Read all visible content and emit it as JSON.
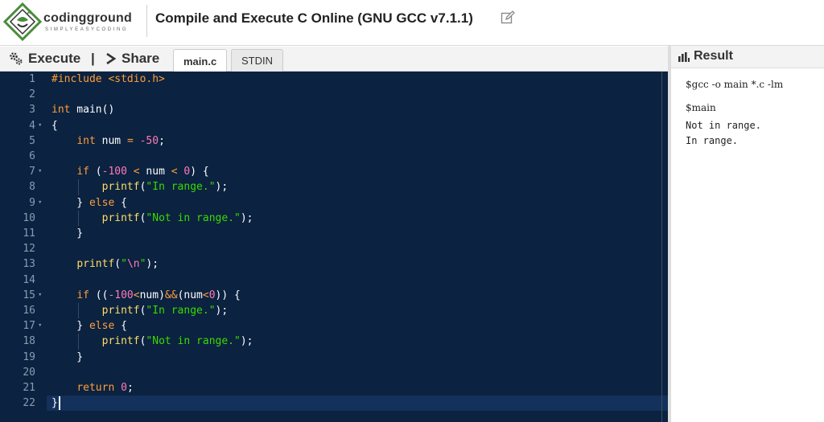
{
  "header": {
    "logo_name": "codingground",
    "logo_tagline": "SIMPLYEASYCODING",
    "title": "Compile and Execute C Online (GNU GCC v7.1.1)",
    "edit_icon": "edit-icon"
  },
  "toolbar": {
    "execute_label": "Execute",
    "execute_icon": "gears-icon",
    "separator": "|",
    "share_label": "Share",
    "share_icon": "chevron-right-icon",
    "tabs": [
      {
        "label": "main.c",
        "active": true
      },
      {
        "label": "STDIN",
        "active": false
      }
    ]
  },
  "editor": {
    "active_line": 22,
    "foldable_lines": [
      4,
      7,
      9,
      15,
      17
    ],
    "lines": [
      [
        [
          "pp",
          "#include <stdio.h>"
        ]
      ],
      [],
      [
        [
          "kw",
          "int"
        ],
        [
          "plain",
          " main()"
        ]
      ],
      [
        [
          "plain",
          "{"
        ]
      ],
      [
        [
          "plain",
          "    "
        ],
        [
          "kw",
          "int"
        ],
        [
          "plain",
          " num "
        ],
        [
          "op",
          "="
        ],
        [
          "plain",
          " "
        ],
        [
          "num",
          "-50"
        ],
        [
          "plain",
          ";"
        ]
      ],
      [],
      [
        [
          "plain",
          "    "
        ],
        [
          "kw",
          "if"
        ],
        [
          "plain",
          " ("
        ],
        [
          "num",
          "-100"
        ],
        [
          "plain",
          " "
        ],
        [
          "op",
          "<"
        ],
        [
          "plain",
          " num "
        ],
        [
          "op",
          "<"
        ],
        [
          "plain",
          " "
        ],
        [
          "num",
          "0"
        ],
        [
          "plain",
          ") {"
        ]
      ],
      [
        [
          "plain",
          "        "
        ],
        [
          "fn",
          "printf"
        ],
        [
          "plain",
          "("
        ],
        [
          "str",
          "\"In range.\""
        ],
        [
          "plain",
          ");"
        ]
      ],
      [
        [
          "plain",
          "    } "
        ],
        [
          "kw",
          "else"
        ],
        [
          "plain",
          " {"
        ]
      ],
      [
        [
          "plain",
          "        "
        ],
        [
          "fn",
          "printf"
        ],
        [
          "plain",
          "("
        ],
        [
          "str",
          "\"Not in range.\""
        ],
        [
          "plain",
          ");"
        ]
      ],
      [
        [
          "plain",
          "    }"
        ]
      ],
      [],
      [
        [
          "plain",
          "    "
        ],
        [
          "fn",
          "printf"
        ],
        [
          "plain",
          "("
        ],
        [
          "str",
          "\""
        ],
        [
          "esc",
          "\\n"
        ],
        [
          "str",
          "\""
        ],
        [
          "plain",
          ");"
        ]
      ],
      [],
      [
        [
          "plain",
          "    "
        ],
        [
          "kw",
          "if"
        ],
        [
          "plain",
          " (("
        ],
        [
          "num",
          "-100"
        ],
        [
          "op",
          "<"
        ],
        [
          "plain",
          "num)"
        ],
        [
          "op",
          "&&"
        ],
        [
          "plain",
          "(num"
        ],
        [
          "op",
          "<"
        ],
        [
          "num",
          "0"
        ],
        [
          "plain",
          ")) {"
        ]
      ],
      [
        [
          "plain",
          "        "
        ],
        [
          "fn",
          "printf"
        ],
        [
          "plain",
          "("
        ],
        [
          "str",
          "\"In range.\""
        ],
        [
          "plain",
          ");"
        ]
      ],
      [
        [
          "plain",
          "    } "
        ],
        [
          "kw",
          "else"
        ],
        [
          "plain",
          " {"
        ]
      ],
      [
        [
          "plain",
          "        "
        ],
        [
          "fn",
          "printf"
        ],
        [
          "plain",
          "("
        ],
        [
          "str",
          "\"Not in range.\""
        ],
        [
          "plain",
          ");"
        ]
      ],
      [
        [
          "plain",
          "    }"
        ]
      ],
      [],
      [
        [
          "plain",
          "    "
        ],
        [
          "kw",
          "return"
        ],
        [
          "plain",
          " "
        ],
        [
          "num",
          "0"
        ],
        [
          "plain",
          ";"
        ]
      ],
      [
        [
          "plain",
          "}"
        ]
      ]
    ]
  },
  "result": {
    "title": "Result",
    "icon": "bar-chart-icon",
    "compile_cmd": "$gcc -o main *.c -lm",
    "run_cmd": "$main",
    "output": "Not in range.\nIn range."
  },
  "colors": {
    "editor_bg": "#0b2240",
    "keyword": "#ff9d3b",
    "number": "#ff7ab8",
    "string": "#3ad900",
    "function": "#ffdd66",
    "logo_green": "#4a8c3a"
  }
}
